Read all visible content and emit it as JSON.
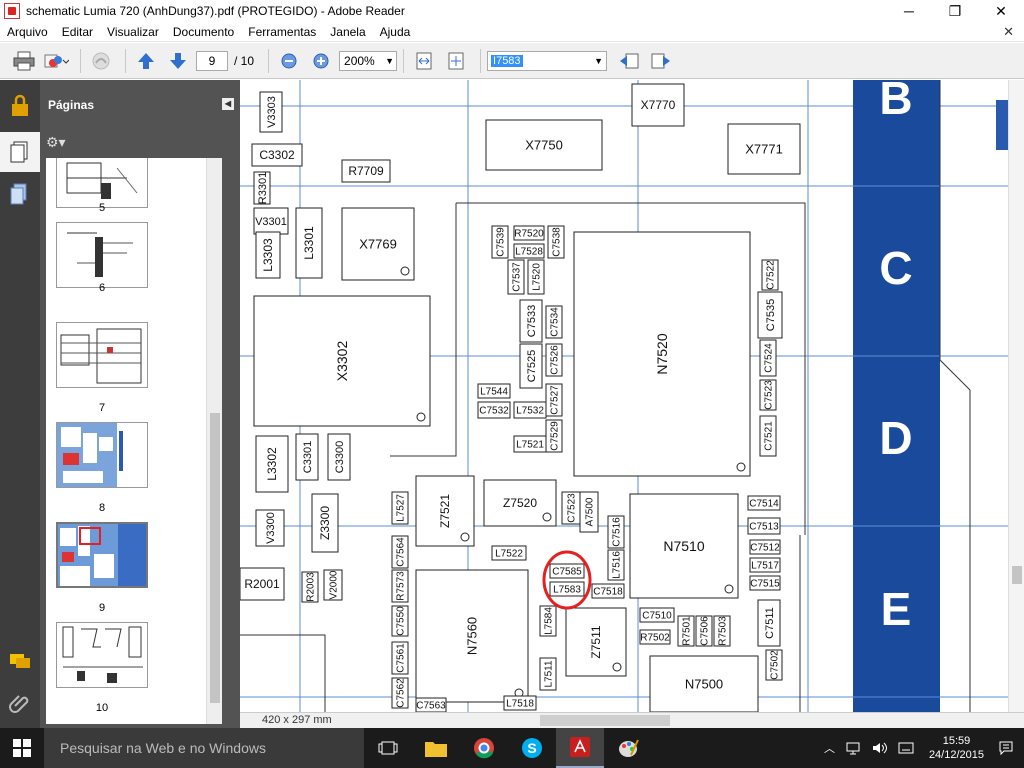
{
  "window": {
    "title": "schematic Lumia 720 (AnhDung37).pdf (PROTEGIDO) - Adobe Reader",
    "minimize": "─",
    "maximize": "❐",
    "close": "✕"
  },
  "menu": {
    "items": [
      "Arquivo",
      "Editar",
      "Visualizar",
      "Documento",
      "Ferramentas",
      "Janela",
      "Ajuda"
    ],
    "close_doc": "✕"
  },
  "toolbar": {
    "page_current": "9",
    "page_total": "/ 10",
    "zoom": "200%",
    "search_value": "I7583"
  },
  "pages_panel": {
    "title": "Páginas",
    "thumb_labels": [
      "5",
      "6",
      "7",
      "8",
      "9",
      "10"
    ],
    "selected_page": "9"
  },
  "document": {
    "page_size": "420 x 297 mm",
    "grid_rows": [
      "B",
      "C",
      "D",
      "E"
    ],
    "components": [
      {
        "id": "V3303",
        "t": "V3303"
      },
      {
        "id": "X7770",
        "t": "X7770"
      },
      {
        "id": "X7750",
        "t": "X7750"
      },
      {
        "id": "X7771",
        "t": "X7771"
      },
      {
        "id": "C3302",
        "t": "C3302"
      },
      {
        "id": "R7709",
        "t": "R7709"
      },
      {
        "id": "R3301",
        "t": "R3301"
      },
      {
        "id": "V3301",
        "t": "V3301"
      },
      {
        "id": "L3303",
        "t": "L3303"
      },
      {
        "id": "L3301",
        "t": "L3301"
      },
      {
        "id": "X7769",
        "t": "X7769"
      },
      {
        "id": "X3302",
        "t": "X3302"
      },
      {
        "id": "N7520",
        "t": "N7520"
      },
      {
        "id": "C7539",
        "t": "C7539"
      },
      {
        "id": "R7520",
        "t": "R7520"
      },
      {
        "id": "L7528",
        "t": "L7528"
      },
      {
        "id": "C7538",
        "t": "C7538"
      },
      {
        "id": "C7537",
        "t": "C7537"
      },
      {
        "id": "L7520",
        "t": "L7520"
      },
      {
        "id": "C7533",
        "t": "C7533"
      },
      {
        "id": "C7534",
        "t": "C7534"
      },
      {
        "id": "C7525",
        "t": "C7525"
      },
      {
        "id": "C7526",
        "t": "C7526"
      },
      {
        "id": "L7544",
        "t": "L7544"
      },
      {
        "id": "C7532",
        "t": "C7532"
      },
      {
        "id": "L7532",
        "t": "L7532"
      },
      {
        "id": "C7527",
        "t": "C7527"
      },
      {
        "id": "L7521",
        "t": "L7521"
      },
      {
        "id": "C7529",
        "t": "C7529"
      },
      {
        "id": "C7522",
        "t": "C7522"
      },
      {
        "id": "C7535",
        "t": "C7535"
      },
      {
        "id": "C7523",
        "t": "C7523"
      },
      {
        "id": "C7524",
        "t": "C7524"
      },
      {
        "id": "C7521",
        "t": "C7521"
      },
      {
        "id": "L3302",
        "t": "L3302"
      },
      {
        "id": "C3301",
        "t": "C3301"
      },
      {
        "id": "C3300",
        "t": "C3300"
      },
      {
        "id": "V3300",
        "t": "V3300"
      },
      {
        "id": "Z3300",
        "t": "Z3300"
      },
      {
        "id": "L7527",
        "t": "L7527"
      },
      {
        "id": "Z7521",
        "t": "Z7521"
      },
      {
        "id": "Z7520",
        "t": "Z7520"
      },
      {
        "id": "C7523b",
        "t": "C7523"
      },
      {
        "id": "A7500",
        "t": "A7500"
      },
      {
        "id": "C7516",
        "t": "C7516"
      },
      {
        "id": "N7510",
        "t": "N7510"
      },
      {
        "id": "C7514",
        "t": "C7514"
      },
      {
        "id": "C7513",
        "t": "C7513"
      },
      {
        "id": "C7512",
        "t": "C7512"
      },
      {
        "id": "L7517",
        "t": "L7517"
      },
      {
        "id": "C7515",
        "t": "C7515"
      },
      {
        "id": "R2001",
        "t": "R2001"
      },
      {
        "id": "R2003",
        "t": "R2003"
      },
      {
        "id": "V2000",
        "t": "V2000"
      },
      {
        "id": "C7564",
        "t": "C7564"
      },
      {
        "id": "R7573",
        "t": "R7573"
      },
      {
        "id": "L7522",
        "t": "L7522"
      },
      {
        "id": "C7585",
        "t": "C7585"
      },
      {
        "id": "L7583",
        "t": "L7583"
      },
      {
        "id": "L7516",
        "t": "L7516"
      },
      {
        "id": "C7518",
        "t": "C7518"
      },
      {
        "id": "C7550",
        "t": "C7550"
      },
      {
        "id": "N7560",
        "t": "N7560"
      },
      {
        "id": "L7584",
        "t": "L7584"
      },
      {
        "id": "Z7511",
        "t": "Z7511"
      },
      {
        "id": "C7510",
        "t": "C7510"
      },
      {
        "id": "R7502",
        "t": "R7502"
      },
      {
        "id": "R7501",
        "t": "R7501"
      },
      {
        "id": "C7506",
        "t": "C7506"
      },
      {
        "id": "R7503",
        "t": "R7503"
      },
      {
        "id": "C7511",
        "t": "C7511"
      },
      {
        "id": "C7561",
        "t": "C7561"
      },
      {
        "id": "C7562",
        "t": "C7562"
      },
      {
        "id": "C7563",
        "t": "C7563"
      },
      {
        "id": "L7511",
        "t": "L7511"
      },
      {
        "id": "L7518",
        "t": "L7518"
      },
      {
        "id": "N7500",
        "t": "N7500"
      },
      {
        "id": "C7502",
        "t": "C7502"
      }
    ]
  },
  "taskbar": {
    "search_placeholder": "Pesquisar na Web e no Windows",
    "time": "15:59",
    "date": "24/12/2015"
  },
  "colors": {
    "band_blue": "#1a4a9b",
    "grid_line": "#5b8fd6",
    "highlight_circle": "#e52020"
  }
}
